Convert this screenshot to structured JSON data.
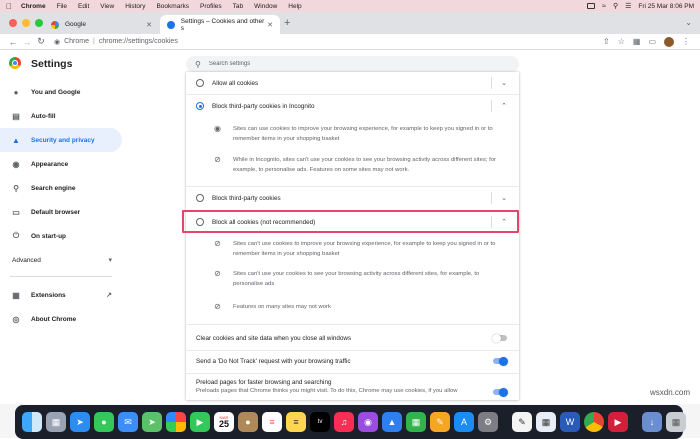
{
  "menubar": {
    "apple": "",
    "app": "Chrome",
    "items": [
      "File",
      "Edit",
      "View",
      "History",
      "Bookmarks",
      "Profiles",
      "Tab",
      "Window",
      "Help"
    ],
    "datetime": "Fri 25 Mar  8:06 PM"
  },
  "tabs": [
    {
      "title": "Google",
      "active": false
    },
    {
      "title": "Settings – Cookies and other s",
      "active": true
    }
  ],
  "toolbar": {
    "chip": "Chrome",
    "url": "chrome://settings/cookies"
  },
  "header": {
    "title": "Settings",
    "search_placeholder": "Search settings"
  },
  "sidebar": {
    "items": [
      {
        "label": "You and Google",
        "icon": "person-icon"
      },
      {
        "label": "Auto-fill",
        "icon": "autofill-icon"
      },
      {
        "label": "Security and privacy",
        "icon": "shield-icon"
      },
      {
        "label": "Appearance",
        "icon": "palette-icon"
      },
      {
        "label": "Search engine",
        "icon": "search-icon"
      },
      {
        "label": "Default browser",
        "icon": "browser-icon"
      },
      {
        "label": "On start-up",
        "icon": "power-icon"
      }
    ],
    "advanced": "Advanced",
    "extensions": "Extensions",
    "about": "About Chrome"
  },
  "cookies": {
    "allow_all": "Allow all cookies",
    "block_incognito": "Block third-party cookies in Incognito",
    "incognito_info_1": "Sites can use cookies to improve your browsing experience, for example to keep you signed in or to remember items in your shopping basket",
    "incognito_info_2": "While in Incognito, sites can't use your cookies to see your browsing activity across different sites; for example, to personalise ads. Features on some sites may not work.",
    "block_third_party": "Block third-party cookies",
    "block_all": "Block all cookies (not recommended)",
    "block_all_info_1": "Sites can't use cookies to improve your browsing experience, for example to keep you signed in or to remember items in your shopping basket",
    "block_all_info_2": "Sites can't use your cookies to see your browsing activity across different sites, for example, to personalise ads",
    "block_all_info_3": "Features on many sites may not work",
    "clear_on_close": "Clear cookies and site data when you close all windows",
    "do_not_track": "Send a 'Do Not Track' request with your browsing traffic",
    "preload_title": "Preload pages for faster browsing and searching",
    "preload_desc": "Preloads pages that Chrome thinks you might visit. To do this, Chrome may use cookies, if you allow"
  },
  "watermark": "wsxdn.com",
  "colors": {
    "accent": "#1a73e8",
    "highlight_border": "#e8446b",
    "menubar_bg": "#f2d8dd"
  }
}
